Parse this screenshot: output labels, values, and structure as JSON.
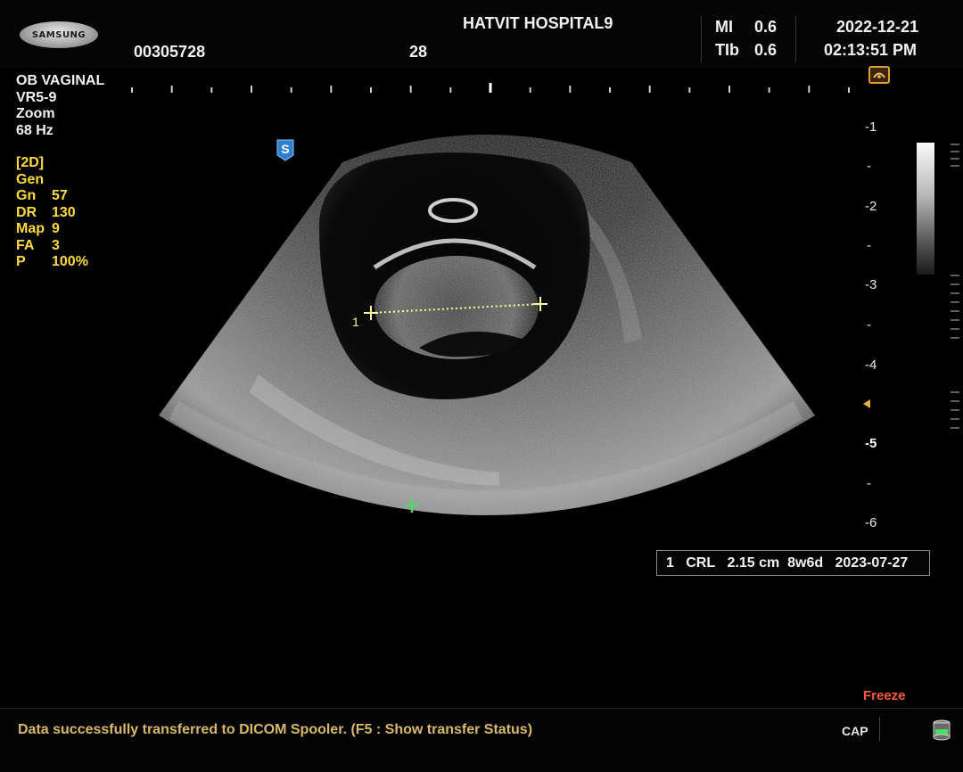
{
  "header": {
    "brand": "SAMSUNG",
    "patient_id": "00305728",
    "frame_number": "28",
    "institution": "HATVIT HOSPITAL9",
    "mi_label": "MI",
    "mi_value": "0.6",
    "tib_label": "TIb",
    "tib_value": "0.6",
    "date": "2022-12-21",
    "time": "02:13:51 PM"
  },
  "params": {
    "preset": "OB VAGINAL",
    "probe": "VR5-9",
    "zoom": "Zoom",
    "frequency": "68 Hz",
    "mode": "[2D]",
    "gen": "Gen",
    "gn_label": "Gn",
    "gn_value": "57",
    "dr_label": "DR",
    "dr_value": "130",
    "map_label": "Map",
    "map_value": "9",
    "fa_label": "FA",
    "fa_value": "3",
    "p_label": "P",
    "p_value": "100%"
  },
  "depth_scale": {
    "labels": [
      "-1",
      "-",
      "-2",
      "-",
      "-3",
      "-",
      "-4",
      "-5",
      "-",
      "-6"
    ]
  },
  "measurement": {
    "caliper_label": "1",
    "index": "1",
    "type": "CRL",
    "value": "2.15 cm",
    "ga": "8w6d",
    "edd": "2023-07-27"
  },
  "markers": {
    "s_marker": "S"
  },
  "status": {
    "freeze": "Freeze",
    "message": "Data successfully transferred to DICOM Spooler. (F5 : Show transfer Status)",
    "cap": "CAP"
  },
  "colors": {
    "param_yellow": "#ffdc3c",
    "status_text": "#d9b86a",
    "freeze_red": "#ff5a3c",
    "caliper_yellow": "#ffff99",
    "caliper_green": "#4cd964",
    "s_marker_blue": "#2f7fd0"
  }
}
